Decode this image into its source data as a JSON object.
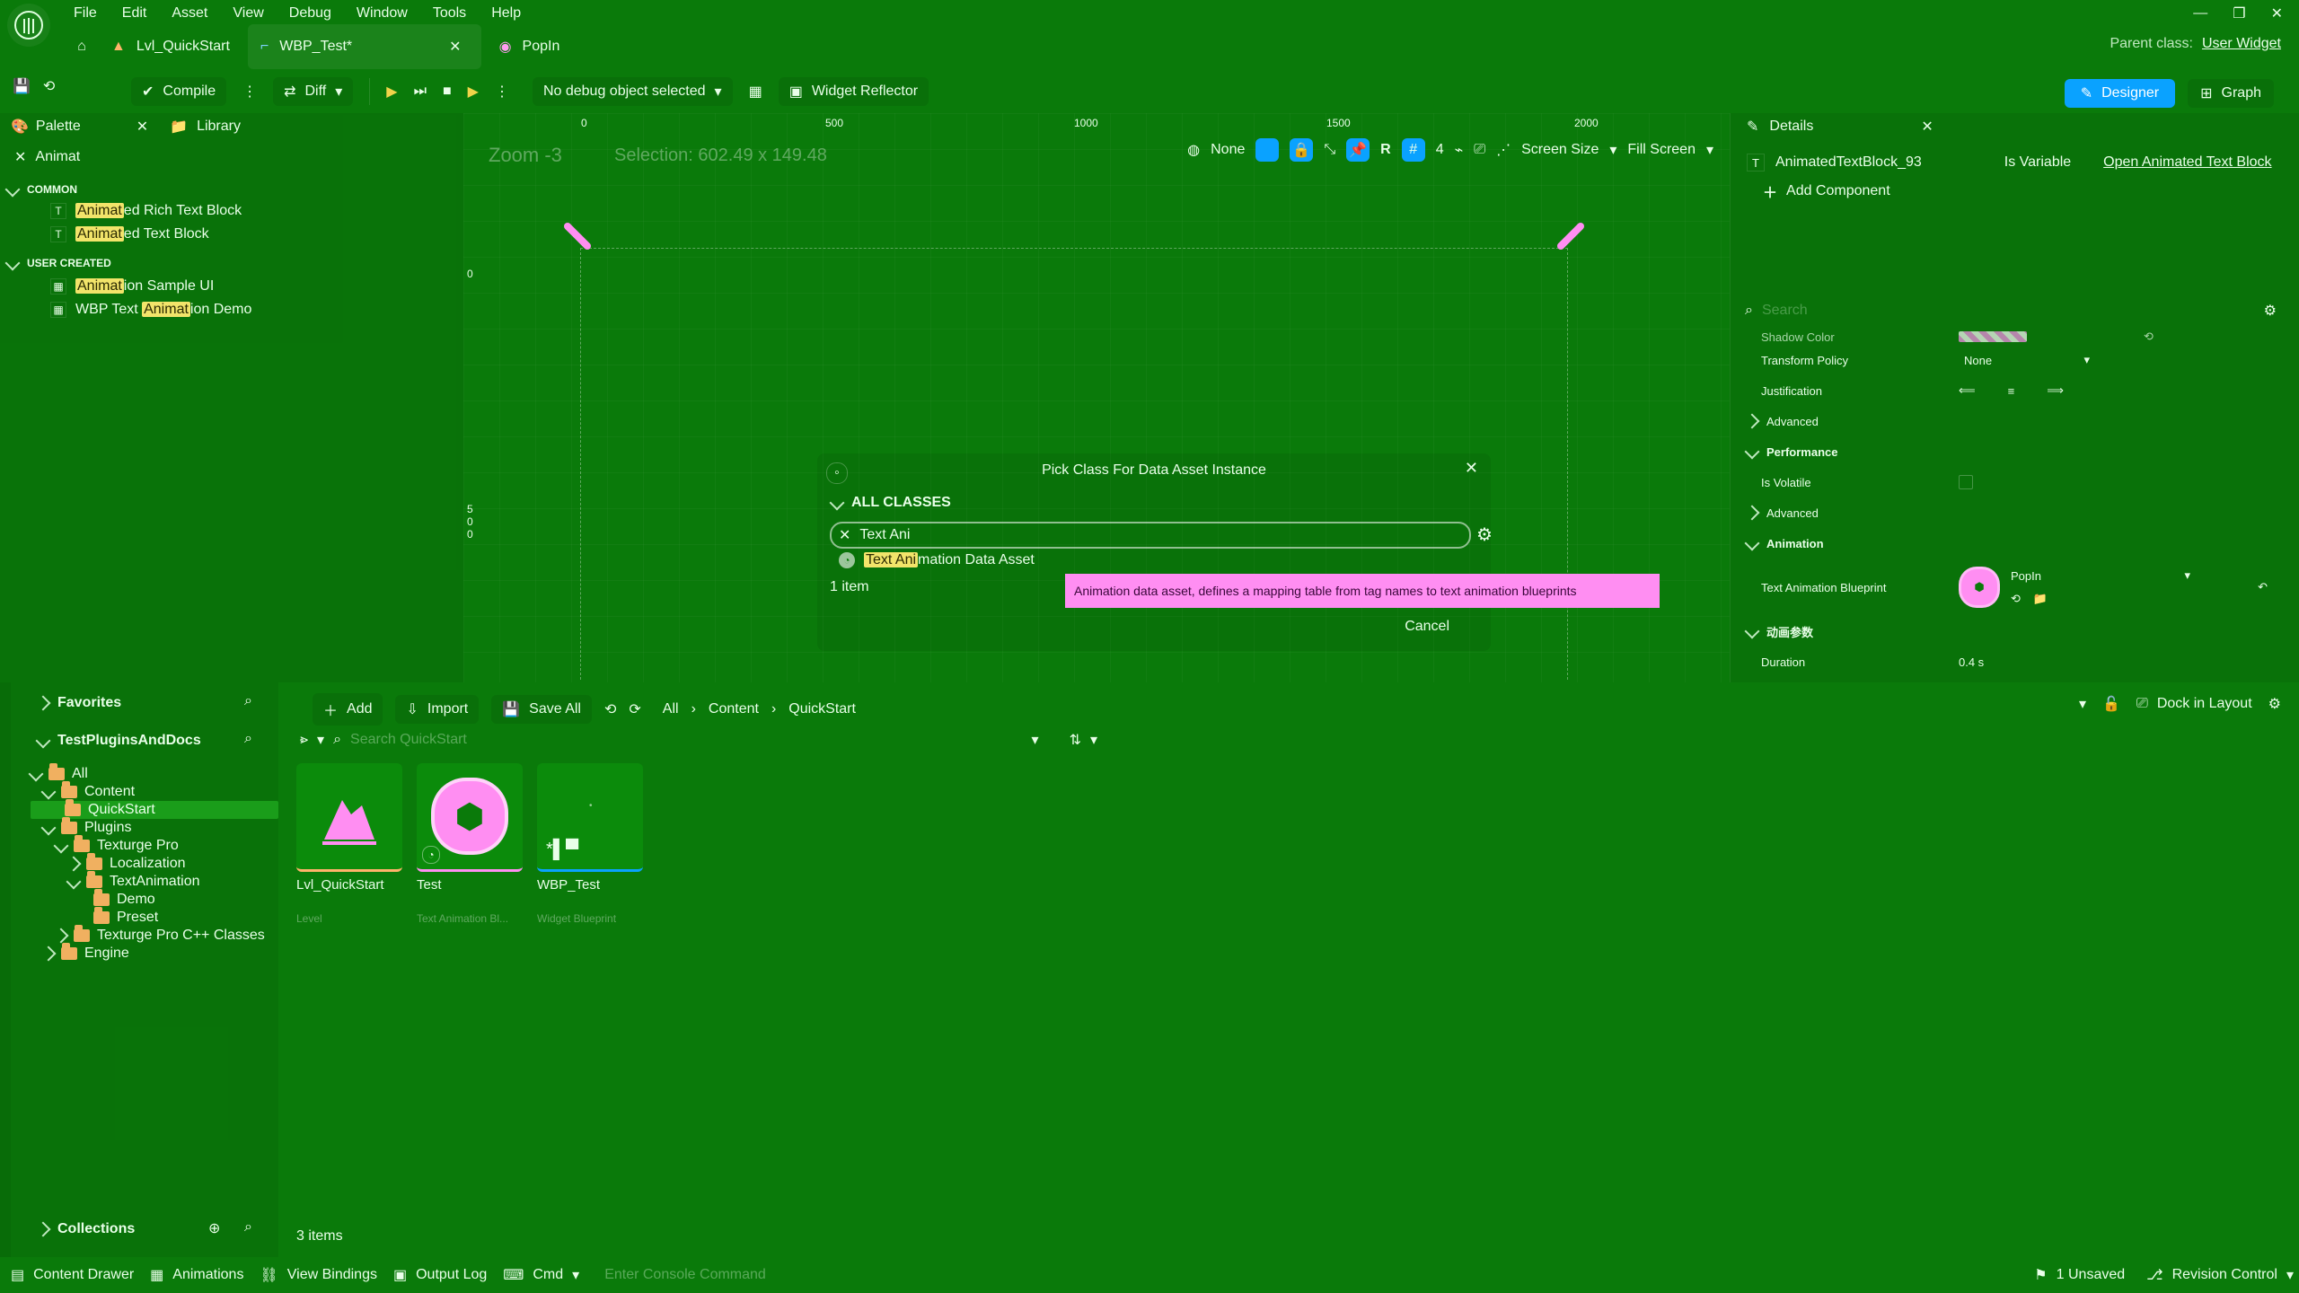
{
  "app": {
    "menu": [
      "File",
      "Edit",
      "Asset",
      "View",
      "Debug",
      "Window",
      "Tools",
      "Help"
    ],
    "tabs": [
      {
        "label": "Lvl_QuickStart",
        "active": false
      },
      {
        "label": "WBP_Test*",
        "active": true
      },
      {
        "label": "PopIn",
        "active": false
      }
    ],
    "parent_class_label": "Parent class:",
    "parent_class_value": "User Widget"
  },
  "toolbar": {
    "compile": "Compile",
    "diff": "Diff",
    "debug_object": "No debug object selected",
    "widget_reflector": "Widget Reflector",
    "designer": "Designer",
    "graph": "Graph"
  },
  "left_panel": {
    "tab_palette": "Palette",
    "tab_library": "Library",
    "search_value": "Animat",
    "sections": [
      {
        "title": "COMMON",
        "items": [
          {
            "pre": "Animat",
            "post": "ed Rich Text Block"
          },
          {
            "pre": "Animat",
            "post": "ed Text Block"
          }
        ]
      },
      {
        "title": "USER CREATED",
        "items": [
          {
            "pre": "Animat",
            "post": "ion Sample UI"
          },
          {
            "pre": "WBP Text ",
            "mid": "Animat",
            "post": "ion Demo"
          }
        ]
      }
    ]
  },
  "viewport": {
    "zoom": "Zoom -3",
    "selection": "Selection: 602.49 x 149.48",
    "ruler_top": [
      "0",
      "500",
      "1000",
      "1500",
      "2000"
    ],
    "ruler_left": [
      "0",
      "5",
      "0",
      "0"
    ],
    "controls": {
      "none": "None",
      "r": "R",
      "four": "4",
      "screen_size": "Screen Size",
      "fill_screen": "Fill Screen"
    }
  },
  "dialog": {
    "title": "Pick Class For Data Asset Instance",
    "section": "ALL CLASSES",
    "search_value": "Text Ani",
    "result_pre": "Text Ani",
    "result_post": "mation Data Asset",
    "count": "1 item",
    "tooltip": "Animation data asset, defines a mapping table from tag names to text animation blueprints",
    "cancel": "Cancel"
  },
  "details": {
    "tab": "Details",
    "object_name": "AnimatedTextBlock_93",
    "is_variable": "Is Variable",
    "open_link": "Open Animated Text Block",
    "add_component": "Add Component",
    "search_placeholder": "Search",
    "rows": [
      {
        "label": "Shadow Color",
        "type": "color"
      },
      {
        "label": "Transform Policy",
        "value": "None",
        "type": "select"
      },
      {
        "label": "Justification",
        "type": "justify"
      },
      {
        "label": "Advanced",
        "type": "group"
      },
      {
        "label": "Performance",
        "type": "section"
      },
      {
        "label": "Is Volatile",
        "type": "checkbox"
      },
      {
        "label": "Advanced",
        "type": "group"
      },
      {
        "label": "Animation",
        "type": "section"
      },
      {
        "label": "Text Animation Blueprint",
        "value": "PopIn",
        "type": "asset"
      },
      {
        "label": "动画参数",
        "type": "section"
      },
      {
        "label": "Duration",
        "value": "0.4 s",
        "type": "number"
      }
    ]
  },
  "content_browser": {
    "favorites": "Favorites",
    "project": "TestPluginsAndDocs",
    "collections": "Collections",
    "buttons": {
      "add": "Add",
      "import": "Import",
      "save_all": "Save All"
    },
    "path": [
      "All",
      "Content",
      "QuickStart"
    ],
    "dock_in_layout": "Dock in Layout",
    "search_placeholder": "Search QuickStart",
    "tree": [
      {
        "label": "All",
        "indent": 0,
        "open": true
      },
      {
        "label": "Content",
        "indent": 1,
        "open": true
      },
      {
        "label": "QuickStart",
        "indent": 2,
        "selected": true
      },
      {
        "label": "Plugins",
        "indent": 1,
        "open": true
      },
      {
        "label": "Texturge Pro",
        "indent": 2,
        "open": true
      },
      {
        "label": "Localization",
        "indent": 3,
        "open": false
      },
      {
        "label": "TextAnimation",
        "indent": 3,
        "open": true
      },
      {
        "label": "Demo",
        "indent": 4
      },
      {
        "label": "Preset",
        "indent": 4
      },
      {
        "label": "Texturge Pro C++ Classes",
        "indent": 2,
        "open": false
      },
      {
        "label": "Engine",
        "indent": 1,
        "open": false
      }
    ],
    "assets": [
      {
        "name": "Lvl_QuickStart",
        "type": "Level"
      },
      {
        "name": "Test",
        "type": "Text Animation Bl..."
      },
      {
        "name": "WBP_Test",
        "type": "Widget Blueprint"
      }
    ],
    "items_count": "3 items"
  },
  "statusbar": {
    "content_drawer": "Content Drawer",
    "animations": "Animations",
    "view_bindings": "View Bindings",
    "output_log": "Output Log",
    "cmd": "Cmd",
    "console_placeholder": "Enter Console Command",
    "unsaved": "1 Unsaved",
    "revision_control": "Revision Control"
  },
  "colors": {
    "background": "#0a7a0a",
    "accent_blue": "#0aa2ff",
    "highlight": "#f2e46a",
    "pink": "#ff8ef2"
  }
}
